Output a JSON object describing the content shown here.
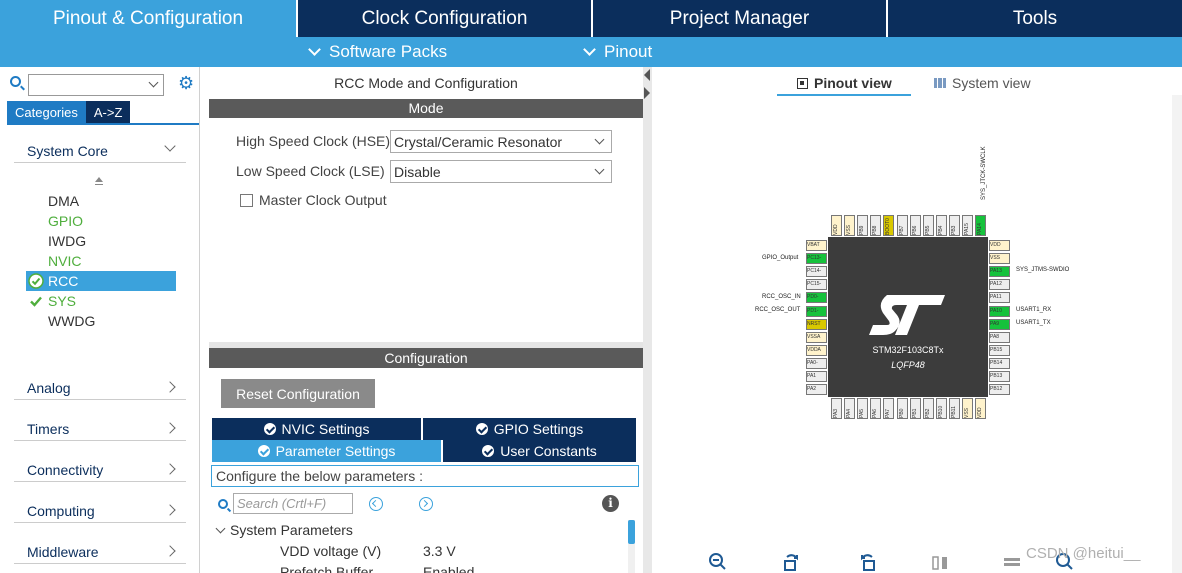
{
  "top_tabs": [
    {
      "label": "Pinout & Configuration",
      "active": true
    },
    {
      "label": "Clock Configuration",
      "active": false
    },
    {
      "label": "Project Manager",
      "active": false
    },
    {
      "label": "Tools",
      "active": false
    }
  ],
  "sub_menu": {
    "software_packs": "Software Packs",
    "pinout": "Pinout"
  },
  "left": {
    "category_tabs": [
      "Categories",
      "A->Z"
    ],
    "groups": [
      "System Core",
      "Analog",
      "Timers",
      "Connectivity",
      "Computing",
      "Middleware"
    ],
    "peripherals": [
      {
        "label": "DMA",
        "state": "plain"
      },
      {
        "label": "GPIO",
        "state": "green"
      },
      {
        "label": "IWDG",
        "state": "plain"
      },
      {
        "label": "NVIC",
        "state": "green"
      },
      {
        "label": "RCC",
        "state": "selected"
      },
      {
        "label": "SYS",
        "state": "green-check"
      },
      {
        "label": "WWDG",
        "state": "plain"
      }
    ]
  },
  "middle": {
    "title": "RCC Mode and Configuration",
    "mode_header": "Mode",
    "hse_label": "High Speed Clock (HSE)",
    "hse_value": "Crystal/Ceramic Resonator",
    "lse_label": "Low Speed Clock (LSE)",
    "lse_value": "Disable",
    "mco_label": "Master Clock Output",
    "configuration_header": "Configuration",
    "reset_button": "Reset Configuration",
    "tabs": {
      "nvic": "NVIC Settings",
      "gpio": "GPIO Settings",
      "parameter": "Parameter Settings",
      "user_constants": "User Constants"
    },
    "configure_hint": "Configure the below parameters :",
    "search_placeholder": "Search (Crtl+F)",
    "system_parameters": "System Parameters",
    "params": [
      {
        "name": "VDD voltage (V)",
        "value": "3.3 V"
      },
      {
        "name": "Prefetch Buffer",
        "value": "Enabled"
      }
    ]
  },
  "right": {
    "pinout_view": "Pinout view",
    "system_view": "System view",
    "chip_name": "STM32F103C8Tx",
    "package": "LQFP48",
    "top_signal": "SYS_JTCK-SWCLK",
    "left_labels": {
      "gpio_output": "GPIO_Output",
      "osc_in": "RCC_OSC_IN",
      "osc_out": "RCC_OSC_OUT"
    },
    "right_labels": {
      "swdio": "SYS_JTMS-SWDIO",
      "rx": "USART1_RX",
      "tx": "USART1_TX"
    },
    "left_pins": [
      "VBAT",
      "PC13-",
      "PC14-",
      "PC15-",
      "PD0-",
      "PD1-",
      "NRST",
      "VSSA",
      "VDDA",
      "PA0-",
      "PA1",
      "PA2"
    ],
    "right_pins": [
      "VDD",
      "VSS",
      "PA13",
      "PA12",
      "PA11",
      "PA10",
      "PA9",
      "PA8",
      "PB15",
      "PB14",
      "PB13",
      "PB12"
    ],
    "top_pins": [
      "VDD",
      "VSS",
      "PB9",
      "PB8",
      "BOOT0",
      "PB7",
      "PB6",
      "PB5",
      "PB4",
      "PB3",
      "PA15",
      "PA14"
    ],
    "bottom_pins": [
      "PA3",
      "PA4",
      "PA5",
      "PA6",
      "PA7",
      "PB0",
      "PB1",
      "PB2",
      "PB10",
      "PB11",
      "VSS",
      "VDD"
    ]
  },
  "watermark": "CSDN @heitui__"
}
